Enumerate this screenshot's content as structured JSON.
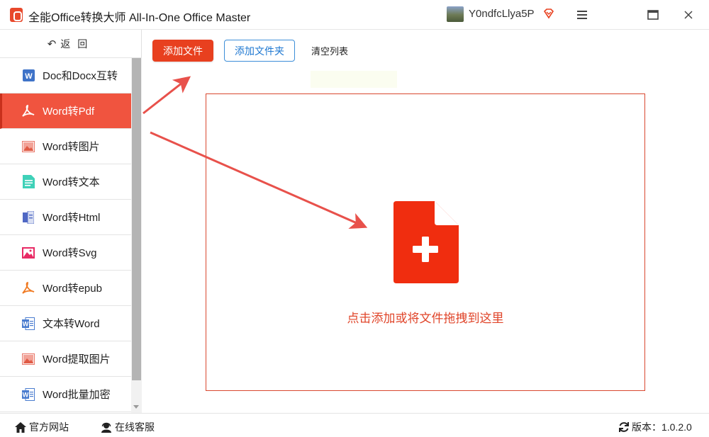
{
  "window": {
    "title": "全能Office转换大师 All-In-One Office Master",
    "username": "Y0ndfcLlya5P"
  },
  "sidebar": {
    "back_label": "返回",
    "items": [
      {
        "label": "Doc和Docx互转",
        "icon": "word-doc-icon",
        "active": false
      },
      {
        "label": "Word转Pdf",
        "icon": "pdf-icon",
        "active": true
      },
      {
        "label": "Word转图片",
        "icon": "image-icon",
        "active": false
      },
      {
        "label": "Word转文本",
        "icon": "text-file-icon",
        "active": false
      },
      {
        "label": "Word转Html",
        "icon": "html-icon",
        "active": false
      },
      {
        "label": "Word转Svg",
        "icon": "svg-image-icon",
        "active": false
      },
      {
        "label": "Word转epub",
        "icon": "epub-icon",
        "active": false
      },
      {
        "label": "文本转Word",
        "icon": "word-icon",
        "active": false
      },
      {
        "label": "Word提取图片",
        "icon": "image-extract-icon",
        "active": false
      },
      {
        "label": "Word批量加密",
        "icon": "word-lock-icon",
        "active": false
      }
    ]
  },
  "toolbar": {
    "add_file": "添加文件",
    "add_folder": "添加文件夹",
    "clear_list": "清空列表"
  },
  "dropzone": {
    "text": "点击添加或将文件拖拽到这里"
  },
  "footer": {
    "site": "官方网站",
    "service": "在线客服",
    "version": "版本：1.0.2.0"
  },
  "colors": {
    "accent": "#e8401f",
    "active_item": "#f0543f",
    "link_blue": "#1f78d1"
  }
}
